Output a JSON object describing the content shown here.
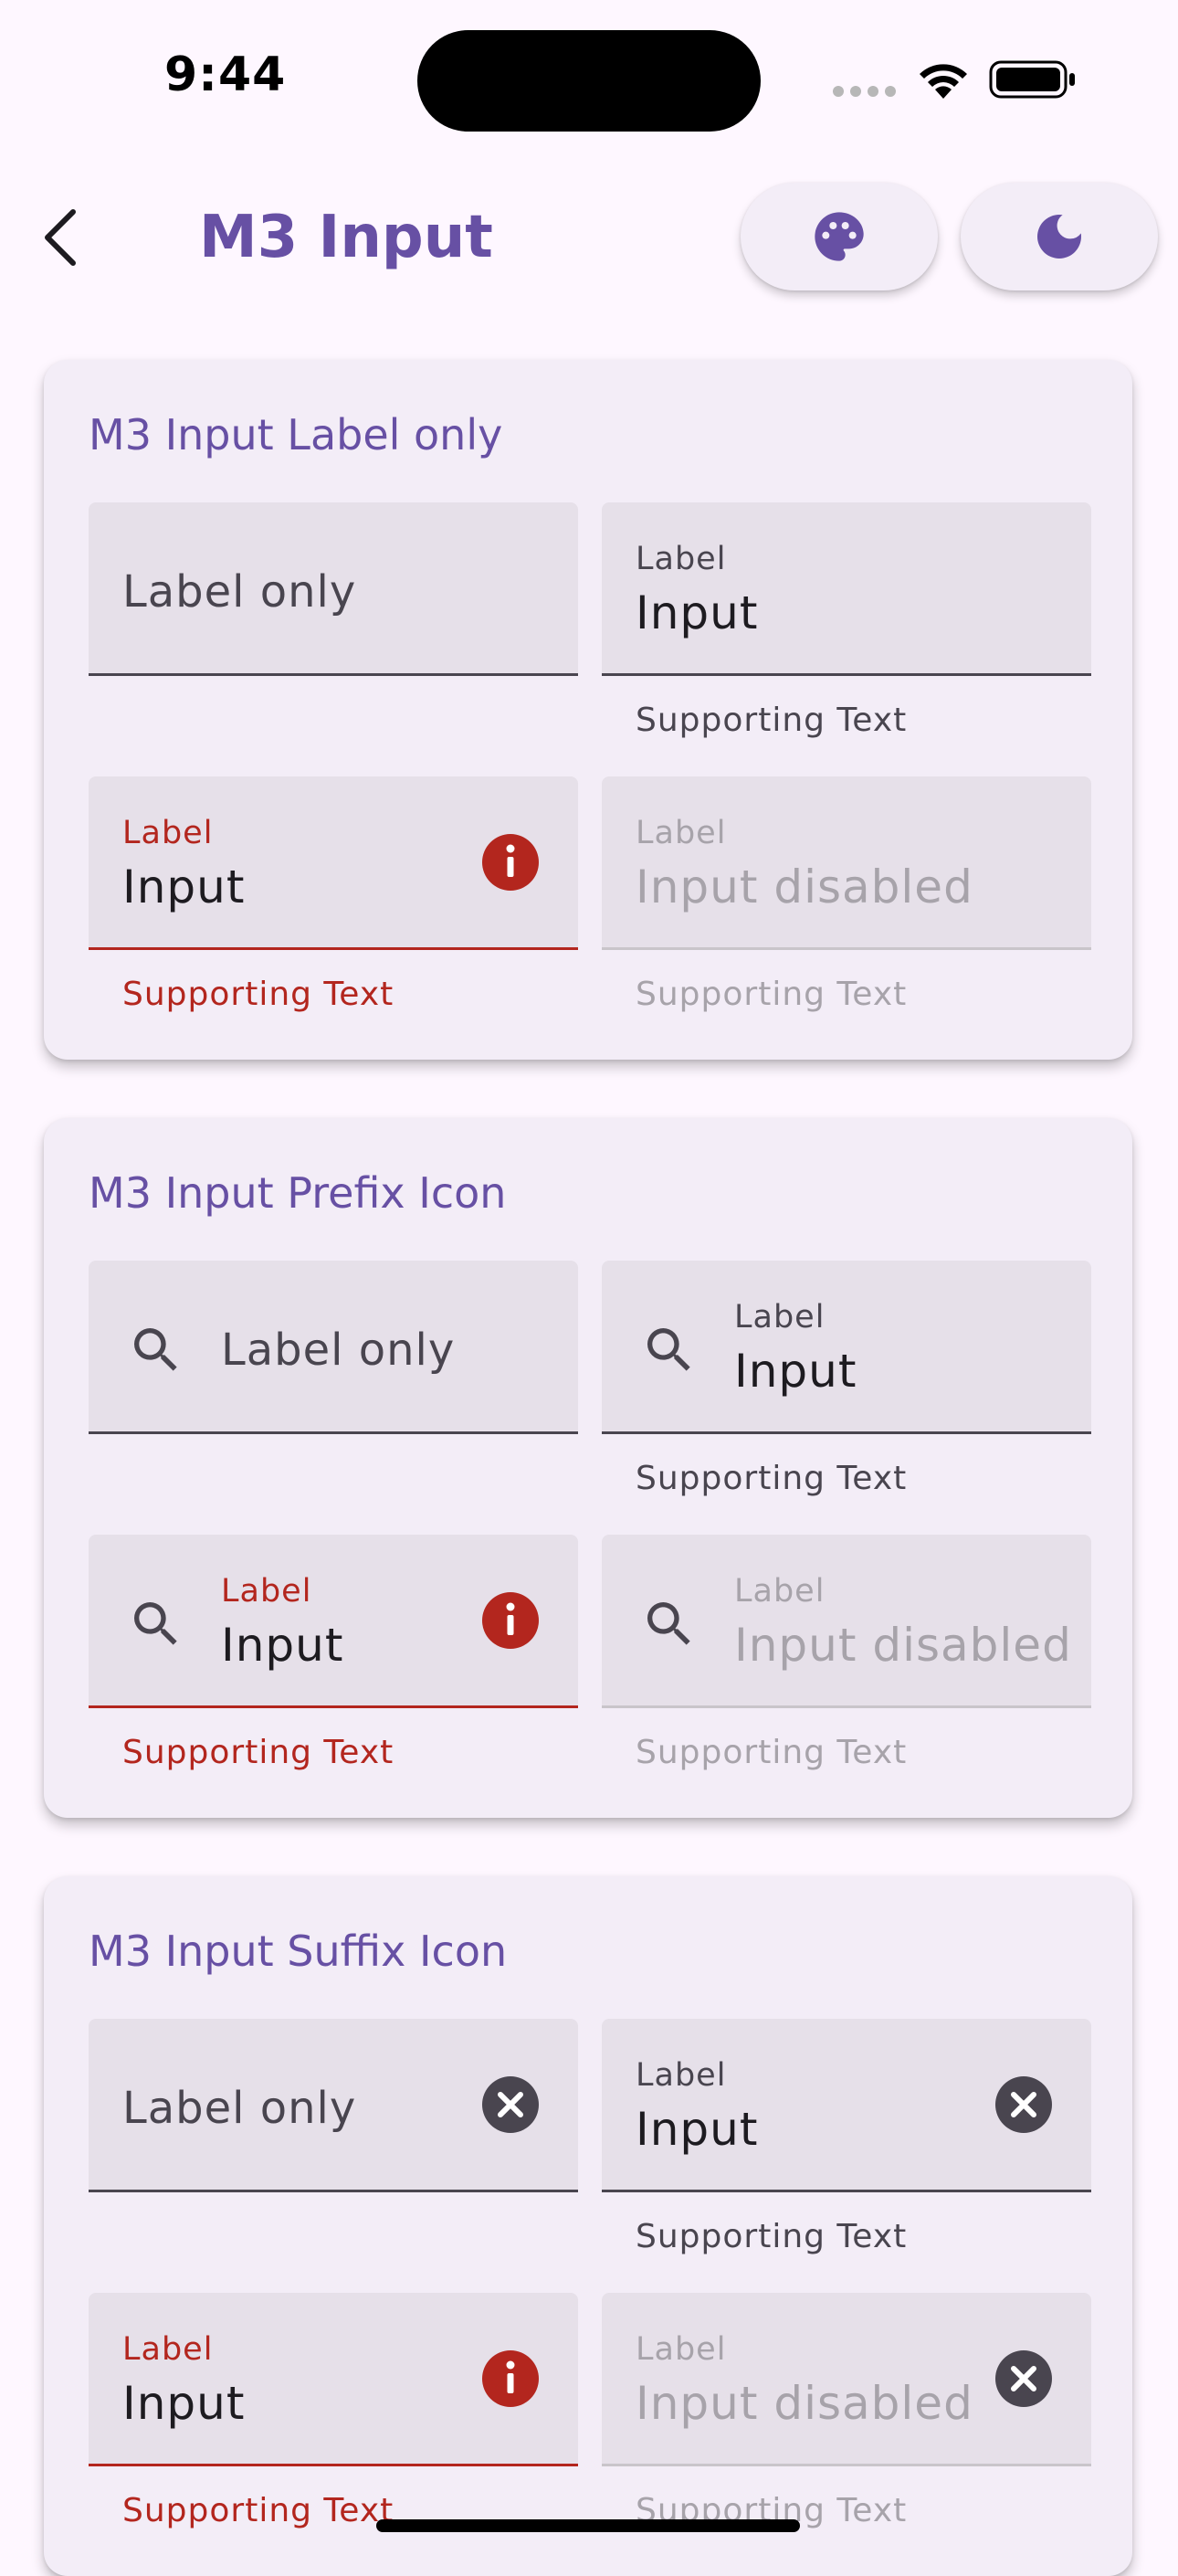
{
  "status_bar": {
    "time": "9:44"
  },
  "app_bar": {
    "title": "M3 Input",
    "back_icon": "back-arrow-icon",
    "actions": [
      {
        "icon": "palette-icon"
      },
      {
        "icon": "dark-mode-moon-icon"
      }
    ]
  },
  "colors": {
    "primary": "#6750a4",
    "error": "#b3261e",
    "surface": "#f3edf7",
    "field": "#e6e0e9"
  },
  "cards": [
    {
      "title": "M3 Input Label only",
      "fields": [
        {
          "label": "Label only"
        },
        {
          "label": "Label",
          "input": "Input",
          "supporting": "Supporting Text"
        },
        {
          "label": "Label",
          "input": "Input",
          "supporting": "Supporting Text",
          "state": "error",
          "suffix_icon": "error-info-icon"
        },
        {
          "label": "Label",
          "input": "Input disabled",
          "supporting": "Supporting Text",
          "state": "disabled"
        }
      ]
    },
    {
      "title": "M3 Input Prefix Icon",
      "fields": [
        {
          "label": "Label only",
          "prefix_icon": "search-icon"
        },
        {
          "label": "Label",
          "input": "Input",
          "supporting": "Supporting Text",
          "prefix_icon": "search-icon"
        },
        {
          "label": "Label",
          "input": "Input",
          "supporting": "Supporting Text",
          "state": "error",
          "prefix_icon": "search-icon",
          "suffix_icon": "error-info-icon"
        },
        {
          "label": "Label",
          "input": "Input disabled",
          "supporting": "Supporting Text",
          "state": "disabled",
          "prefix_icon": "search-icon"
        }
      ]
    },
    {
      "title": "M3 Input Suffix Icon",
      "fields": [
        {
          "label": "Label only",
          "suffix_icon": "clear-icon"
        },
        {
          "label": "Label",
          "input": "Input",
          "supporting": "Supporting Text",
          "suffix_icon": "clear-icon"
        },
        {
          "label": "Label",
          "input": "Input",
          "supporting": "Supporting Text",
          "state": "error",
          "suffix_icon": "error-info-icon"
        },
        {
          "label": "Label",
          "input": "Input disabled",
          "supporting": "Supporting Text",
          "state": "disabled",
          "suffix_icon": "clear-icon"
        }
      ]
    }
  ]
}
